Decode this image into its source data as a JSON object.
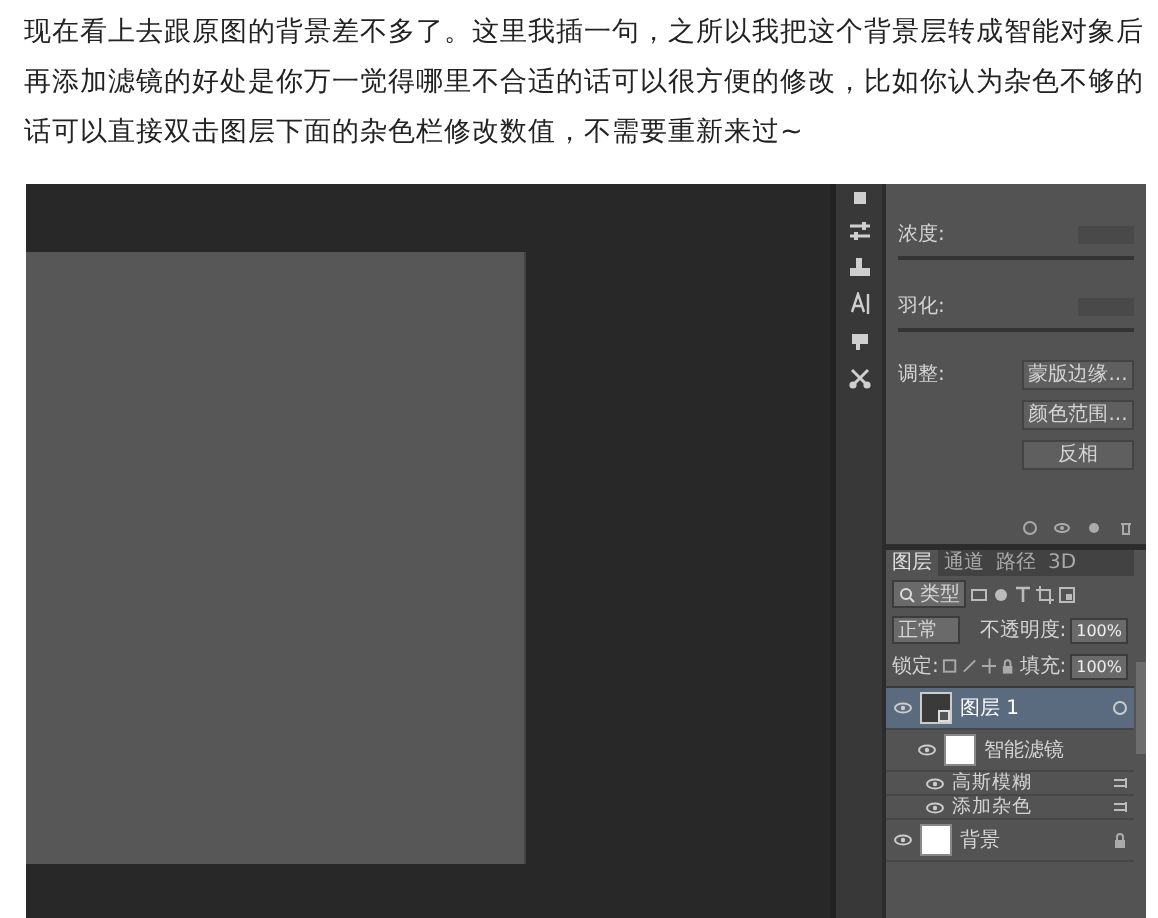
{
  "article": {
    "paragraph": "现在看上去跟原图的背景差不多了。这里我插一句，之所以我把这个背景层转成智能对象后再添加滤镜的好处是你万一觉得哪里不合适的话可以很方便的修改，比如你认为杂色不够的话可以直接双击图层下面的杂色栏修改数值，不需要重新来过~"
  },
  "photoshop": {
    "properties": {
      "sliders": [
        {
          "label": "浓度:"
        },
        {
          "label": "羽化:"
        }
      ],
      "adjust": {
        "label": "调整:",
        "buttons": [
          "蒙版边缘...",
          "颜色范围...",
          "反相"
        ]
      }
    },
    "layers_panel": {
      "tabs": [
        {
          "label": "图层",
          "selected": true
        },
        {
          "label": "通道",
          "selected": false
        },
        {
          "label": "路径",
          "selected": false
        },
        {
          "label": "3D",
          "selected": false
        }
      ],
      "filter": {
        "label": "类型"
      },
      "blend_mode": "正常",
      "opacity": {
        "label": "不透明度:",
        "value": "100%"
      },
      "lock": {
        "label": "锁定:"
      },
      "fill": {
        "label": "填充:",
        "value": "100%"
      },
      "layers": [
        {
          "kind": "layer",
          "name": "图层 1",
          "selected": true,
          "visible": true,
          "smart": true,
          "locked": false,
          "children": [
            {
              "kind": "smart_filters",
              "name": "智能滤镜",
              "visible": true,
              "children": [
                {
                  "kind": "filter",
                  "name": "高斯模糊",
                  "visible": true
                },
                {
                  "kind": "filter",
                  "name": "添加杂色",
                  "visible": true
                }
              ]
            }
          ]
        },
        {
          "kind": "layer",
          "name": "背景",
          "selected": false,
          "visible": true,
          "smart": false,
          "locked": true
        }
      ]
    }
  }
}
